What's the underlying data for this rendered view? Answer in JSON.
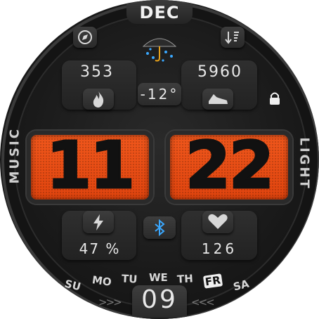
{
  "month": "DEC",
  "weather": {
    "temperature": "-12°",
    "icon": "umbrella-rain-icon"
  },
  "stats": {
    "top_left_value": "353",
    "top_right_value": "5960",
    "bottom_left_value": "47 %",
    "bottom_right_value": "126"
  },
  "time": {
    "hours": "11",
    "minutes": "22"
  },
  "side_labels": {
    "left": "MUSIC",
    "right": "LIGHT"
  },
  "weekdays": [
    "SU",
    "MO",
    "TU",
    "WE",
    "TH",
    "FR",
    "SA"
  ],
  "active_weekday_index": 5,
  "date": "09",
  "colors": {
    "accent": "#e8511a",
    "background": "#1a1a1a",
    "bluetooth": "#3aa8ff"
  },
  "icons": [
    "compass-icon",
    "sort-icon",
    "flame-icon",
    "shoe-icon",
    "lock-icon",
    "bolt-icon",
    "bluetooth-icon",
    "heart-icon"
  ]
}
